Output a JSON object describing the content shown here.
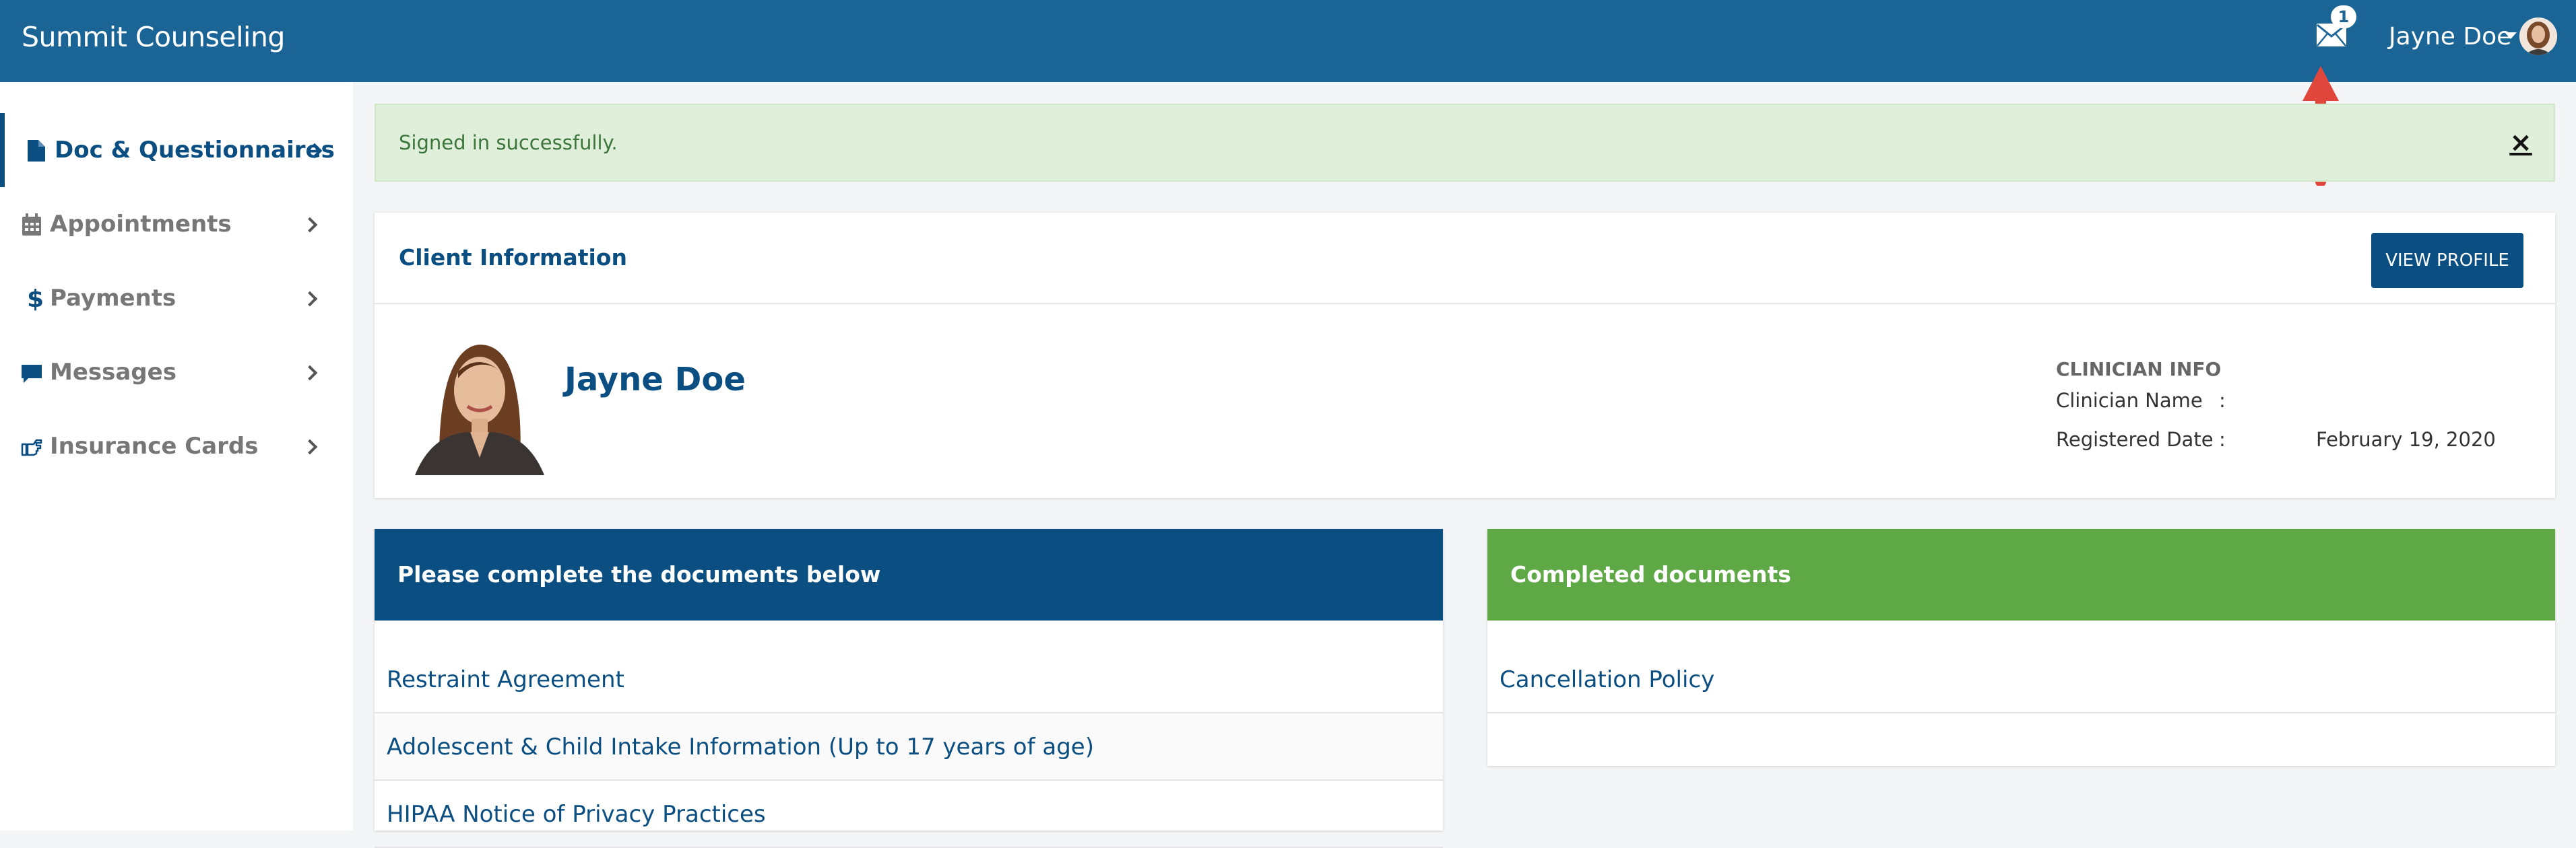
{
  "app": {
    "title": "Summit Counseling"
  },
  "header": {
    "mail_badge": "1",
    "user_name": "Jayne Doe"
  },
  "sidebar": {
    "items": [
      {
        "label": "Doc & Questionnaires",
        "icon": "file-icon",
        "active": true
      },
      {
        "label": "Appointments",
        "icon": "calendar-icon"
      },
      {
        "label": "Payments",
        "icon": "dollar-icon"
      },
      {
        "label": "Messages",
        "icon": "comment-icon"
      },
      {
        "label": "Insurance Cards",
        "icon": "hand-pointing-icon"
      }
    ]
  },
  "alert": {
    "message": "Signed in successfully.",
    "close": "×"
  },
  "client": {
    "title": "Client Information",
    "view_profile": "VIEW PROFILE",
    "name": "Jayne Doe",
    "clinician_title": "CLINICIAN INFO",
    "clinician_name_label": "Clinician Name",
    "clinician_name_value": "",
    "registered_label": "Registered Date",
    "registered_value": "February 19, 2020",
    "colon": ":"
  },
  "pending": {
    "title": "Please complete the documents below",
    "docs": [
      "Restraint Agreement",
      "Adolescent & Child Intake Information (Up to 17 years of age)",
      "HIPAA Notice of Privacy Practices"
    ]
  },
  "completed": {
    "title": "Completed documents",
    "docs": [
      "Cancellation Policy"
    ]
  },
  "colors": {
    "header": "#1a6496",
    "primary": "#0b4f82",
    "success": "#5ea946",
    "alert_bg": "#dfefd9"
  }
}
